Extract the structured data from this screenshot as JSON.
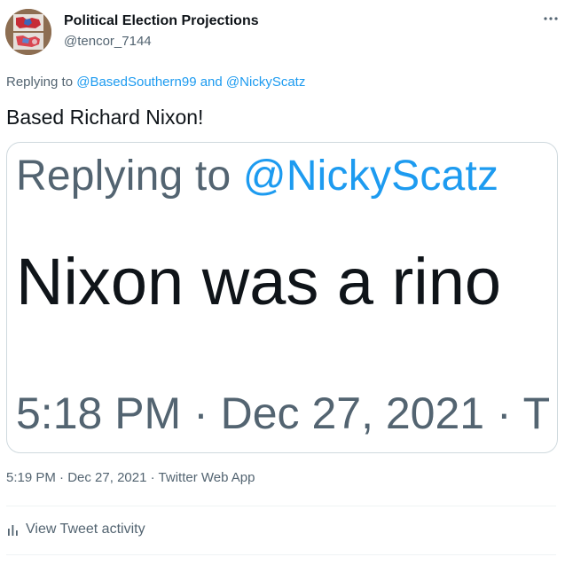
{
  "header": {
    "display_name": "Political Election Projections",
    "handle": "@tencor_7144",
    "avatar_icon": "map-avatar-icon",
    "more_icon": "more-dots-icon"
  },
  "reply_context": {
    "prefix": "Replying to",
    "user1": "@BasedSouthern99",
    "conjunction": "and",
    "user2": "@NickyScatz"
  },
  "tweet": {
    "text": "Based Richard Nixon!"
  },
  "media": {
    "reply_prefix": "Replying to",
    "reply_user": "@NickyScatz",
    "text": "Nixon was a rino",
    "meta": "5:18 PM · Dec 27, 2021 · T"
  },
  "footer": {
    "time": "5:19 PM",
    "sep1": "·",
    "date": "Dec 27, 2021",
    "sep2": "·",
    "source": "Twitter Web App",
    "activity_label": "View Tweet activity",
    "activity_icon": "bar-chart-icon"
  },
  "colors": {
    "link": "#1d9bf0",
    "secondary": "#536471",
    "text": "#0f1419"
  }
}
